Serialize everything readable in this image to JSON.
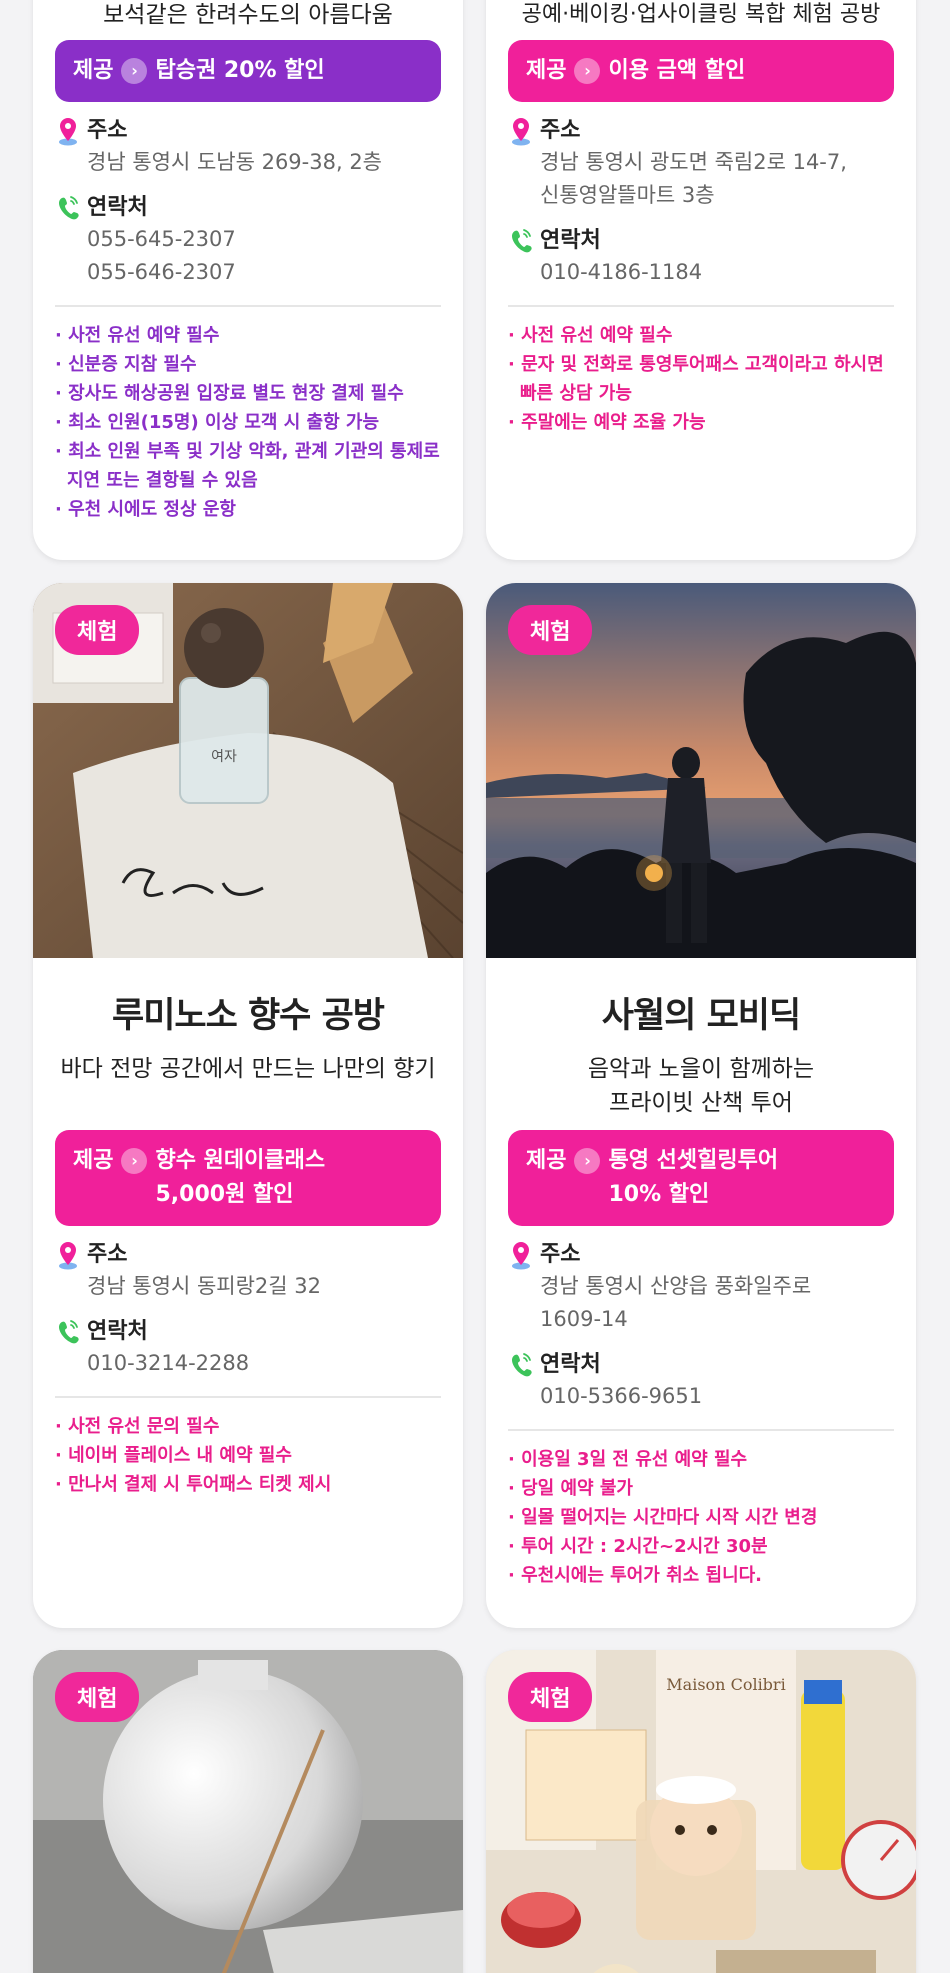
{
  "colors": {
    "purple": "#8a2fc8",
    "pink": "#f0209a"
  },
  "cards": [
    {
      "subtitle": "보석같은 한려수도의 아름다움",
      "offer": {
        "label": "제공",
        "text": "탑승권 20% 할인",
        "color": "purple"
      },
      "address_label": "주소",
      "address": "경남 통영시 도남동 269-38, 2층",
      "contact_label": "연락처",
      "contact": "055-645-2307\n055-646-2307",
      "notes": [
        "· 사전 유선 예약 필수",
        "· 신분증 지참 필수",
        "· 장사도 해상공원 입장료 별도 현장 결제 필수",
        "· 최소 인원(15명) 이상 모객 시 출항 가능",
        "· 최소 인원 부족 및 기상 악화, 관계 기관의 통제로 지연 또는 결항될 수 있음",
        "· 우천 시에도 정상 운항"
      ]
    },
    {
      "subtitle": "공예·베이킹·업사이클링 복합 체험 공방",
      "offer": {
        "label": "제공",
        "text": "이용 금액 할인",
        "color": "pink"
      },
      "address_label": "주소",
      "address": "경남 통영시 광도면 죽림2로 14-7,\n신통영알뜰마트 3층",
      "contact_label": "연락처",
      "contact": "010-4186-1184",
      "notes": [
        "· 사전 유선 예약 필수",
        "· 문자 및 전화로 통영투어패스 고객이라고 하시면 빠른 상담 가능",
        "· 주말에는 예약 조율 가능"
      ]
    },
    {
      "tag": "체험",
      "title": "루미노소 향수 공방",
      "subtitle": "바다 전망 공간에서 만드는 나만의 향기",
      "offer": {
        "label": "제공",
        "text": "향수 원데이클래스\n5,000원 할인",
        "color": "pink"
      },
      "address_label": "주소",
      "address": "경남 통영시 동피랑2길 32",
      "contact_label": "연락처",
      "contact": "010-3214-2288",
      "notes": [
        "· 사전 유선 문의 필수",
        "· 네이버 플레이스 내 예약 필수",
        "· 만나서 결제 시 투어패스 티켓 제시"
      ]
    },
    {
      "tag": "체험",
      "title": "사월의 모비딕",
      "subtitle": "음악과 노을이 함께하는\n프라이빗 산책 투어",
      "offer": {
        "label": "제공",
        "text": "통영 선셋힐링투어\n10% 할인",
        "color": "pink"
      },
      "address_label": "주소",
      "address": "경남 통영시 산양읍 풍화일주로\n1609-14",
      "contact_label": "연락처",
      "contact": "010-5366-9651",
      "notes": [
        "· 이용일 3일 전 유선 예약 필수",
        "· 당일 예약 불가",
        "· 일몰 떨어지는 시간마다 시작 시간 변경",
        "· 투어 시간 : 2시간~2시간 30분",
        "· 우천시에는 투어가 취소 됩니다."
      ]
    },
    {
      "tag": "체험"
    },
    {
      "tag": "체험",
      "package_text": "Maison Colibri"
    }
  ]
}
